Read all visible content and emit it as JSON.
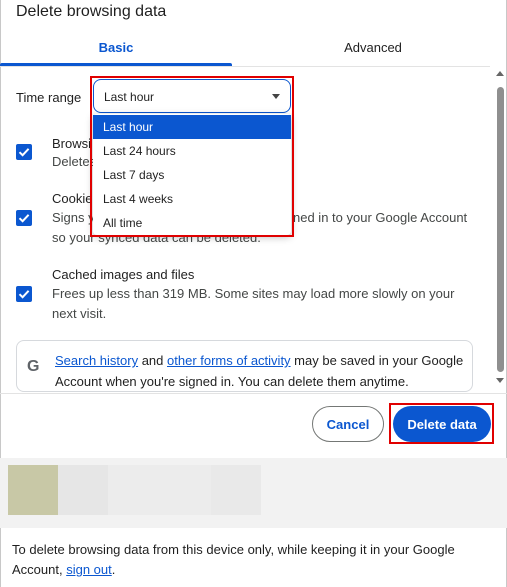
{
  "dialog": {
    "title": "Delete browsing data",
    "tabs": [
      {
        "label": "Basic",
        "active": true
      },
      {
        "label": "Advanced",
        "active": false
      }
    ]
  },
  "time_range": {
    "label": "Time range",
    "selected": "Last hour",
    "options": [
      "Last hour",
      "Last 24 hours",
      "Last 7 days",
      "Last 4 weeks",
      "All time"
    ]
  },
  "items": [
    {
      "title": "Browsing history",
      "title_visible": "Browsi",
      "desc_visible": "Deletes",
      "checked": true
    },
    {
      "title": "Cookies and other site data",
      "title_visible": "Cookie",
      "desc_line1_left": "Signs y",
      "desc_line1_right": "ned in to your Google Account",
      "desc_line2": "so your synced data can be deleted.",
      "checked": true
    },
    {
      "title": "Cached images and files",
      "desc": "Frees up less than 319 MB. Some sites may load more slowly on your next visit.",
      "desc_line1": "Frees up less than 319 MB. Some sites may load more slowly on your",
      "desc_line2": "next visit.",
      "checked": true
    }
  ],
  "google_notice": {
    "icon": "google-g-icon",
    "glyph": "G",
    "link1": "Search history",
    "and": " and ",
    "link2": "other forms of activity",
    "rest1": " may be saved in your Google",
    "line2": "Account when you're signed in. You can delete them anytime."
  },
  "buttons": {
    "cancel": "Cancel",
    "delete": "Delete data"
  },
  "bottom": {
    "line1": "To delete browsing data from this device only, while keeping it in your Google",
    "line2_pre": "Account, ",
    "sign_out": "sign out",
    "line2_post": "."
  },
  "colors": {
    "accent": "#0b57d0",
    "highlight": "#e00000"
  }
}
